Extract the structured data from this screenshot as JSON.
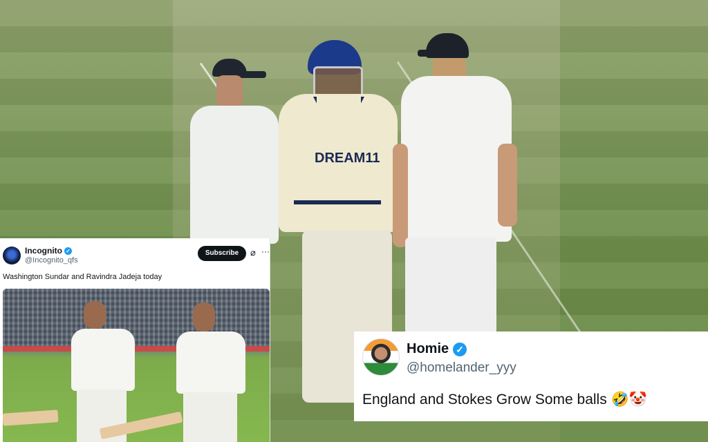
{
  "background": {
    "description_colors": {
      "field": "#6f8f4c",
      "pitch": "#b9b99a"
    },
    "jersey_sponsor": "DREAM11"
  },
  "tweet_small": {
    "name": "Incognito",
    "handle": "@Incognito_qfs",
    "subscribe_label": "Subscribe",
    "text": "Washington Sundar and Ravindra Jadeja today",
    "icons": [
      "verified-icon",
      "grok-icon",
      "more-icon"
    ]
  },
  "tweet_big": {
    "name": "Homie",
    "handle": "@homelander_yyy",
    "text": "England and Stokes Grow Some balls 🤣🤡",
    "icons": [
      "verified-icon"
    ]
  }
}
